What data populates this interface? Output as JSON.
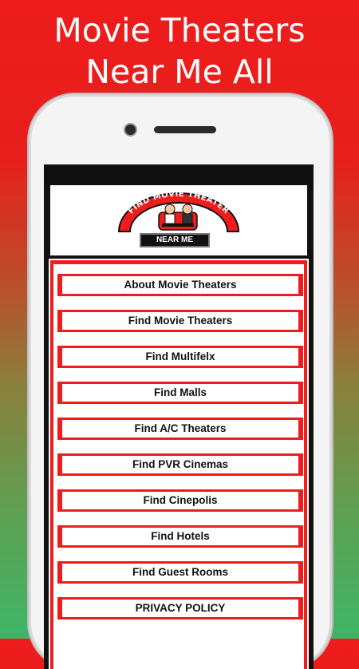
{
  "headline": {
    "line1": "Movie Theaters",
    "line2": "Near Me All"
  },
  "logo": {
    "arc_text": "FIND MOVIE THEATER",
    "badge_text": "NEAR ME"
  },
  "menu": {
    "items": [
      {
        "label": "About Movie Theaters"
      },
      {
        "label": "Find Movie Theaters"
      },
      {
        "label": "Find Multifelx"
      },
      {
        "label": "Find Malls"
      },
      {
        "label": "Find A/C Theaters"
      },
      {
        "label": "Find PVR Cinemas"
      },
      {
        "label": "Find Cinepolis"
      },
      {
        "label": "Find Hotels"
      },
      {
        "label": "Find Guest Rooms"
      },
      {
        "label": "PRIVACY POLICY"
      }
    ]
  },
  "colors": {
    "accent_red": "#ee1c1c",
    "gradient_bottom_green": "#3fb567"
  }
}
